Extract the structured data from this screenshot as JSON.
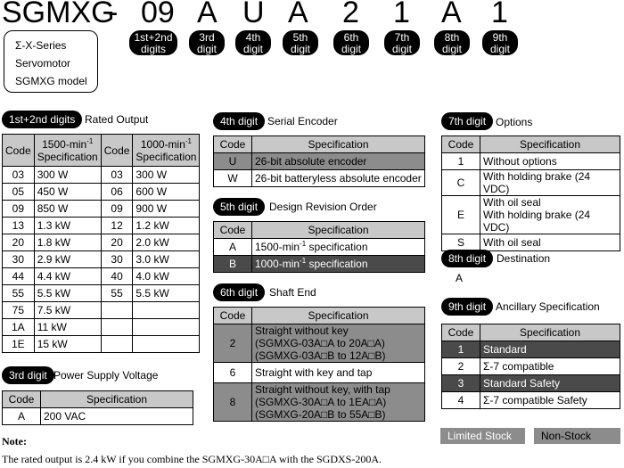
{
  "model": {
    "chars": [
      "SGMXG",
      "-",
      "09",
      "A",
      "U",
      "A",
      "2",
      "1",
      "A",
      "1"
    ],
    "digit_labels": [
      {
        "line1": "1st+2nd",
        "line2": "digits"
      },
      {
        "line1": "3rd",
        "line2": "digit"
      },
      {
        "line1": "4th",
        "line2": "digit"
      },
      {
        "line1": "5th",
        "line2": "digit"
      },
      {
        "line1": "6th",
        "line2": "digit"
      },
      {
        "line1": "7th",
        "line2": "digit"
      },
      {
        "line1": "8th",
        "line2": "digit"
      },
      {
        "line1": "9th",
        "line2": "digit"
      }
    ],
    "series_lines": [
      "Σ-X-Series",
      "Servomotor",
      "SGMXG model"
    ]
  },
  "rated_output": {
    "pill": "1st+2nd digits",
    "title": "Rated Output",
    "col_code": "Code",
    "col_spec_1500": "1500-min",
    "col_spec_1000": "1000-min",
    "sup": "-1",
    "spec_word": "Specification",
    "rows": [
      [
        "03",
        "300 W",
        "03",
        "300 W"
      ],
      [
        "05",
        "450 W",
        "06",
        "600 W"
      ],
      [
        "09",
        "850 W",
        "09",
        "900 W"
      ],
      [
        "13",
        "1.3 kW",
        "12",
        "1.2 kW"
      ],
      [
        "20",
        "1.8 kW",
        "20",
        "2.0 kW"
      ],
      [
        "30",
        "2.9 kW",
        "30",
        "3.0 kW"
      ],
      [
        "44",
        "4.4 kW",
        "40",
        "4.0 kW"
      ],
      [
        "55",
        "5.5 kW",
        "55",
        "5.5 kW"
      ],
      [
        "75",
        "7.5 kW",
        "",
        ""
      ],
      [
        "1A",
        "11 kW",
        "",
        ""
      ],
      [
        "1E",
        "15 kW",
        "",
        ""
      ]
    ]
  },
  "power_supply": {
    "pill": "3rd digit",
    "title": "Power Supply Voltage",
    "col_code": "Code",
    "col_spec": "Specification",
    "rows": [
      [
        "A",
        "200 VAC"
      ]
    ]
  },
  "serial_encoder": {
    "pill": "4th digit",
    "title": "Serial Encoder",
    "col_code": "Code",
    "col_spec": "Specification",
    "rows": [
      {
        "code": "U",
        "spec": "26-bit absolute encoder",
        "style": "limited"
      },
      {
        "code": "W",
        "spec": "26-bit batteryless absolute encoder",
        "style": ""
      }
    ]
  },
  "design_revision": {
    "pill": "5th digit",
    "title": "Design Revision Order",
    "col_code": "Code",
    "col_spec": "Specification",
    "rows": [
      {
        "code": "A",
        "spec_a": "1500-min",
        "sup": "-1",
        "spec_b": " specification",
        "style": ""
      },
      {
        "code": "B",
        "spec_a": "1000-min",
        "sup": "-1",
        "spec_b": " specification",
        "style": "nonstock"
      }
    ]
  },
  "shaft_end": {
    "pill": "6th digit",
    "title": "Shaft End",
    "col_code": "Code",
    "col_spec": "Specification",
    "rows": [
      {
        "code": "2",
        "lines": [
          "Straight without key",
          "(SGMXG-03A□A to 20A□A)",
          "(SGMXG-03A□B to 12A□B)"
        ],
        "style": "limited"
      },
      {
        "code": "6",
        "lines": [
          "Straight with key and tap"
        ],
        "style": ""
      },
      {
        "code": "8",
        "lines": [
          "Straight without key, with tap",
          "(SGMXG-30A□A to 1EA□A)",
          "(SGMXG-20A□B to 55A□B)"
        ],
        "style": "limited"
      }
    ]
  },
  "options": {
    "pill": "7th digit",
    "title": "Options",
    "col_code": "Code",
    "col_spec": "Specification",
    "rows": [
      {
        "code": "1",
        "lines": [
          "Without options"
        ]
      },
      {
        "code": "C",
        "lines": [
          "With holding brake (24 VDC)"
        ]
      },
      {
        "code": "E",
        "lines": [
          "With oil seal",
          "With holding brake (24 VDC)"
        ]
      },
      {
        "code": "S",
        "lines": [
          "With oil seal"
        ]
      }
    ]
  },
  "destination": {
    "pill": "8th digit",
    "title": "Destination",
    "value": "A"
  },
  "ancillary": {
    "pill": "9th digit",
    "title": "Ancillary Specification",
    "col_code": "Code",
    "col_spec": "Specification",
    "rows": [
      {
        "code": "1",
        "spec": "Standard",
        "style": "nonstock"
      },
      {
        "code": "2",
        "spec": "Σ-7 compatible",
        "style": ""
      },
      {
        "code": "3",
        "spec": "Standard Safety",
        "style": "nonstock"
      },
      {
        "code": "4",
        "spec": "Σ-7 compatible Safety",
        "style": ""
      }
    ]
  },
  "legend": {
    "limited": "Limited Stock",
    "nonstock": "Non-Stock"
  },
  "note": {
    "heading": "Note:",
    "text": "The rated output is 2.4 kW if you combine the SGMXG-30A□A with the SGDXS-200A."
  },
  "colors": {
    "limited": "#8c8c8c",
    "nonstock": "#4a4a4a",
    "header": "#c8c8c8"
  }
}
